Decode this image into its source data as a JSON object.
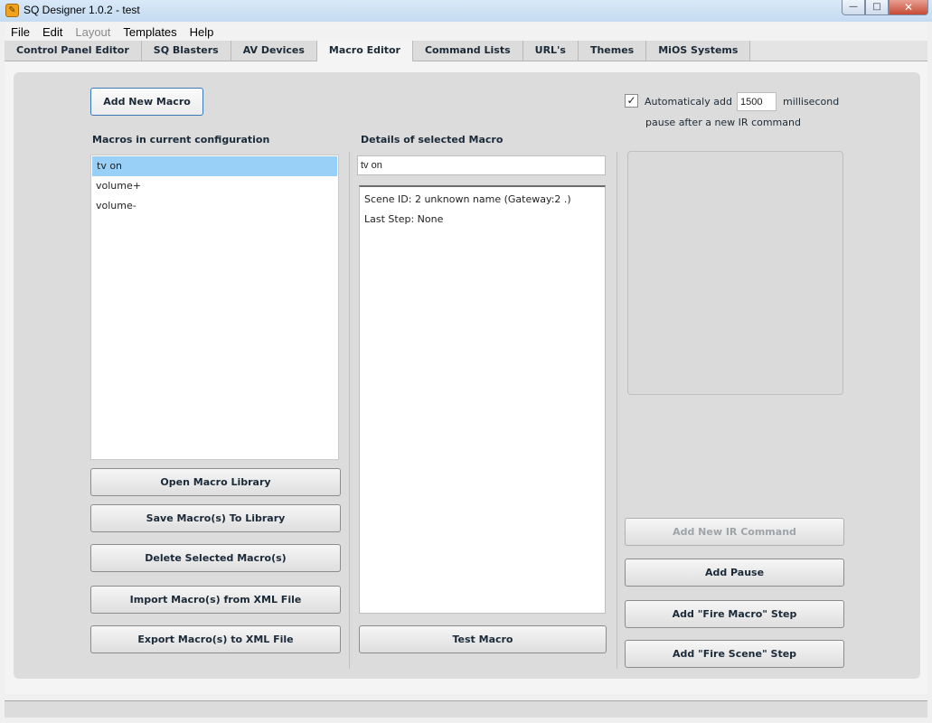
{
  "window": {
    "title": "SQ Designer 1.0.2 - test",
    "min_symbol": "—",
    "max_symbol": "□",
    "close_symbol": "✕"
  },
  "menu": [
    "File",
    "Edit",
    "Layout",
    "Templates",
    "Help"
  ],
  "tabs": [
    "Control Panel Editor",
    "SQ Blasters",
    "AV Devices",
    "Macro Editor",
    "Command Lists",
    "URL's",
    "Themes",
    "MiOS Systems"
  ],
  "active_tab": "Macro Editor",
  "left": {
    "add_button": "Add New Macro",
    "list_title": "Macros in current configuration",
    "macros": [
      "tv on",
      "volume+",
      "volume-"
    ],
    "selected_macro": "tv on",
    "buttons": {
      "open_library": "Open Macro Library",
      "save_library": "Save Macro(s) To Library",
      "delete": "Delete Selected Macro(s)",
      "import_xml": "Import Macro(s) from XML File",
      "export_xml": "Export Macro(s) to XML File"
    }
  },
  "middle": {
    "title": "Details of selected Macro",
    "name_value": "tv on",
    "details_lines": [
      "Scene ID: 2 unknown name (Gateway:2       .)",
      "Last Step: None"
    ],
    "test_button": "Test Macro"
  },
  "right": {
    "auto_checked": true,
    "check_glyph": "✓",
    "auto_label": "Automaticaly add",
    "pause_value": "1500",
    "unit_label": "millisecond",
    "after_label": "pause after a new IR command",
    "buttons": {
      "add_ir": "Add New IR Command",
      "add_pause": "Add Pause",
      "fire_macro": "Add \"Fire Macro\" Step",
      "fire_scene": "Add \"Fire Scene\" Step"
    }
  }
}
